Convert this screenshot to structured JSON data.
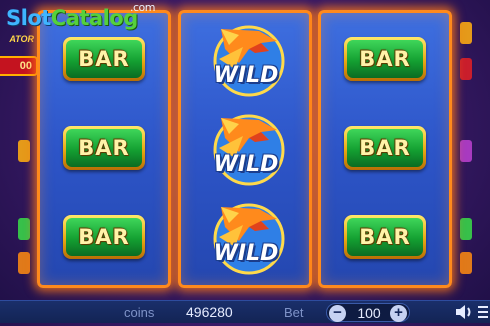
{
  "logo": {
    "part1": "Slot",
    "part2": "Catalog",
    "suffix": ".com"
  },
  "left_panel": {
    "title_fragment": "ATOR",
    "value_fragment": "00"
  },
  "reels": [
    {
      "symbols": [
        "BAR",
        "BAR",
        "BAR"
      ]
    },
    {
      "symbols": [
        "WILD",
        "WILD",
        "WILD"
      ]
    },
    {
      "symbols": [
        "BAR",
        "BAR",
        "BAR"
      ]
    }
  ],
  "bottom_bar": {
    "coins_label": "coins",
    "coins_value": "496280",
    "bet_label": "Bet",
    "bet_value": "100",
    "minus_label": "−",
    "plus_label": "+"
  },
  "colors": {
    "reel_border": "#ff8a1c",
    "reel_bg": "#2d55c8",
    "bar_green": "#14a032",
    "bar_gold": "#e8a812",
    "wild_blue": "#1b3d8c"
  }
}
